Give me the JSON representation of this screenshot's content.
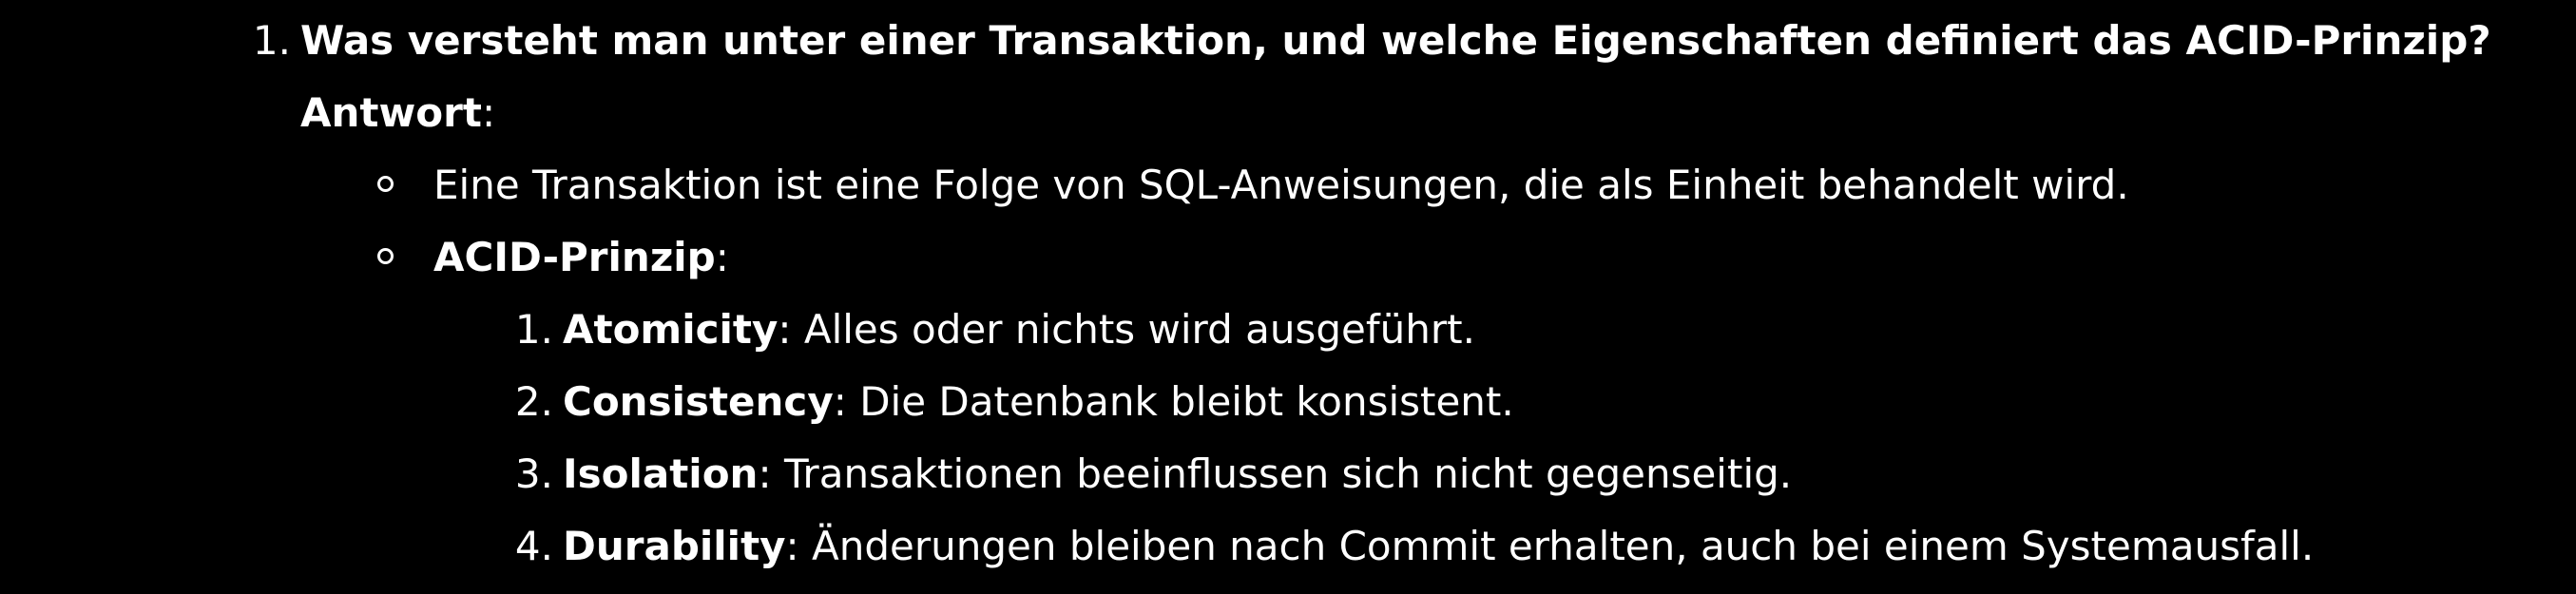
{
  "question": {
    "number": "1.",
    "text": "Was versteht man unter einer Transaktion, und welche Eigenschaften definiert das ACID-Prinzip?"
  },
  "answer": {
    "label": "Antwort",
    "colon": ":"
  },
  "bullets": [
    {
      "text": "Eine Transaktion ist eine Folge von SQL-Anweisungen, die als Einheit behandelt wird."
    },
    {
      "bold": "ACID-Prinzip",
      "text": ":"
    }
  ],
  "acid_items": [
    {
      "number": "1.",
      "term": "Atomicity",
      "text": ": Alles oder nichts wird ausgeführt."
    },
    {
      "number": "2.",
      "term": "Consistency",
      "text": ": Die Datenbank bleibt konsistent."
    },
    {
      "number": "3.",
      "term": "Isolation",
      "text": ": Transaktionen beeinflussen sich nicht gegenseitig."
    },
    {
      "number": "4.",
      "term": "Durability",
      "text": ": Änderungen bleiben nach Commit erhalten, auch bei einem Systemausfall."
    }
  ]
}
